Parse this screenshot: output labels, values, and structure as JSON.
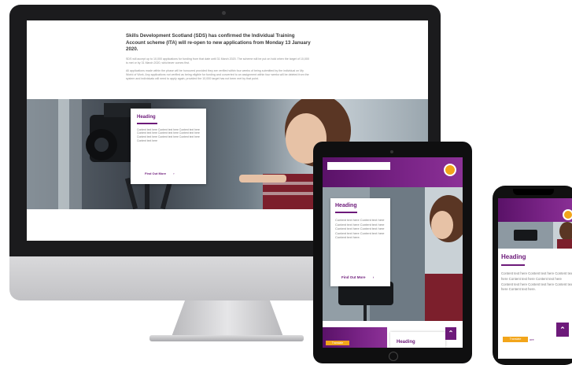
{
  "desktop": {
    "notice_title": "Skills Development Scotland (SDS) has confirmed the Individual Training Account scheme (ITA) will re-open to new applications from Monday 13 January 2020.",
    "notice_p1": "SDS will accept up to 10,000 applications for funding from that date until 31 March 2020. The scheme will be put on hold when the target of 10,000 is met or by 31 March 2020, whichever comes first.",
    "notice_p2": "All applications made within the phase will be honoured provided they are verified within four weeks of being submitted by the individual on My World of Work. Any applications not verified as being eligible for funding and converted to an assignment within four weeks will be deleted from the system and individuals will need to apply again, provided the 10,000 target has not been met by that point.",
    "card": {
      "heading": "Heading",
      "body": "Content text here Content text here Content text here Content text here Content text here Content text here Content text here Content text here Content text here Content text here",
      "link": "Find Out More",
      "arrow": "›"
    }
  },
  "tablet": {
    "card": {
      "heading": "Heading",
      "body": "Content text here Content text here Content text here Content text here Content text here Content text here Content text here Content text here Content text here.",
      "link": "Find Out More",
      "arrow": "›"
    },
    "bottom_heading": "Heading",
    "orange_label": "Translate",
    "scroll_icon": "double-chevron-up-icon"
  },
  "phone": {
    "heading": "Heading",
    "body": "Content text here Content text here Content text here Content text here Content text here Content text here Content text here Content text here Content text here.",
    "orange_label": "Translate",
    "more_label": "ore",
    "scroll_icon": "double-chevron-up-icon"
  },
  "colors": {
    "brand_purple": "#6d1a7a",
    "accent_orange": "#f2a51a"
  }
}
